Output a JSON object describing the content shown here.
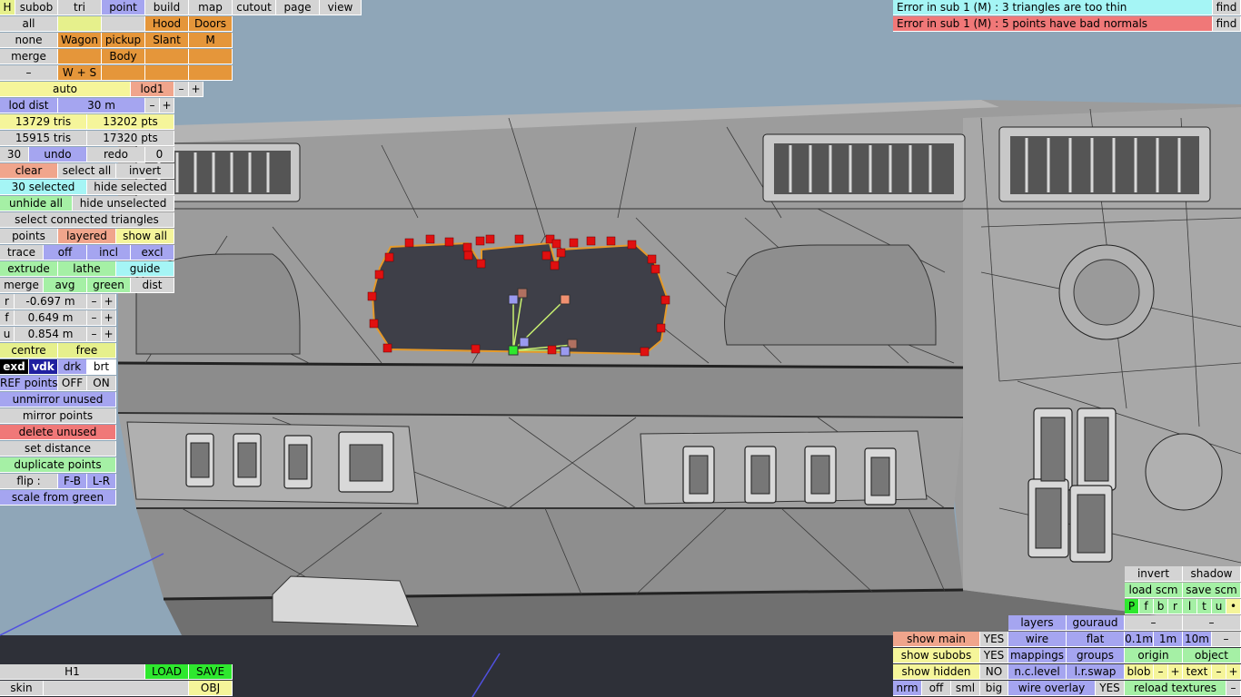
{
  "mode_bar": {
    "h": "H",
    "subob": "subob",
    "tri": "tri",
    "point": "point",
    "build": "build",
    "map": "map",
    "cutout": "cutout",
    "page": "page",
    "view": "view"
  },
  "subob_grid": {
    "all": "all",
    "none": "none",
    "merge": "merge",
    "minus": "–",
    "hood": "Hood",
    "doors": "Doors",
    "wagon": "Wagon",
    "pickup": "pickup",
    "slant": "Slant",
    "m": "M",
    "body": "Body",
    "ws": "W + S"
  },
  "lod": {
    "auto": "auto",
    "lod1": "lod1",
    "minus": "–",
    "plus": "+",
    "lod_dist": "lod dist",
    "dist_value": "30 m"
  },
  "stats": {
    "tris1": "13729 tris",
    "pts1": "13202 pts",
    "tris2": "15915 tris",
    "pts2": "17320 pts"
  },
  "history": {
    "count": "30",
    "undo": "undo",
    "redo": "redo",
    "redo_count": "0"
  },
  "selection": {
    "clear": "clear",
    "select_all": "select all",
    "invert": "invert",
    "selected": "30 selected",
    "hide_selected": "hide selected",
    "unhide_all": "unhide all",
    "hide_unselected": "hide unselected",
    "select_connected": "select connected triangles"
  },
  "tools": {
    "points": "points",
    "layered": "layered",
    "show_all": "show all",
    "trace": "trace",
    "off": "off",
    "incl": "incl",
    "excl": "excl",
    "extrude": "extrude",
    "lathe": "lathe",
    "guide": "guide",
    "merge": "merge",
    "avg": "avg",
    "green": "green",
    "dist": "dist"
  },
  "coords": {
    "r_label": "r",
    "r_value": "-0.697 m",
    "f_label": "f",
    "f_value": "0.649 m",
    "u_label": "u",
    "u_value": "0.854 m",
    "minus": "–",
    "plus": "+"
  },
  "pivot": {
    "centre": "centre",
    "free": "free"
  },
  "colour_modes": {
    "exd": "exd",
    "vdk": "vdk",
    "drk": "drk",
    "brt": "brt"
  },
  "ref_points": {
    "label": "REF points",
    "off": "OFF",
    "on": "ON"
  },
  "actions": {
    "unmirror": "unmirror unused",
    "mirror": "mirror points",
    "delete_unused": "delete unused",
    "set_distance": "set distance",
    "duplicate": "duplicate points",
    "flip": "flip :",
    "fb": "F-B",
    "lr": "L-R",
    "scale": "scale from green"
  },
  "errors": [
    {
      "text": "Error in sub 1 (M) : 3 triangles are too thin",
      "find": "find"
    },
    {
      "text": "Error in sub 1 (M) : 5 points have bad normals",
      "find": "find"
    }
  ],
  "bottom_left": {
    "h1": "H1",
    "load": "LOAD",
    "save": "SAVE",
    "skin": "skin",
    "obj": "OBJ"
  },
  "view_panel": {
    "show_main": "show main",
    "yes1": "YES",
    "show_subobs": "show subobs",
    "yes2": "YES",
    "show_hidden": "show hidden",
    "no": "NO",
    "nrm": "nrm",
    "off": "off",
    "sml": "sml",
    "big": "big",
    "layers": "layers",
    "gouraud": "gouraud",
    "wire": "wire",
    "flat": "flat",
    "mappings": "mappings",
    "groups": "groups",
    "nc_level": "n.c.level",
    "lr_swap": "l.r.swap",
    "wire_overlay": "wire overlay",
    "yes3": "YES",
    "invert": "invert",
    "shadow": "shadow",
    "load_scm": "load scm",
    "save_scm": "save scm",
    "letters": [
      "P",
      "f",
      "b",
      "r",
      "l",
      "t",
      "u",
      "•"
    ],
    "dash1": "–",
    "dash2": "–",
    "d01": "0.1m",
    "d1": "1m",
    "d10": "10m",
    "dash3": "–",
    "origin": "origin",
    "object": "object",
    "blob": "blob",
    "blob_minus": "–",
    "blob_plus": "+",
    "text": "text",
    "text_minus": "–",
    "text_plus": "+",
    "reload": "reload textures",
    "dash4": "–"
  },
  "colors": {
    "sky": "#8fa6b8",
    "mesh": "#9a9a9a",
    "outline": "#e59a2a",
    "point": "#e01010",
    "selected_point": "#2ee82e"
  }
}
